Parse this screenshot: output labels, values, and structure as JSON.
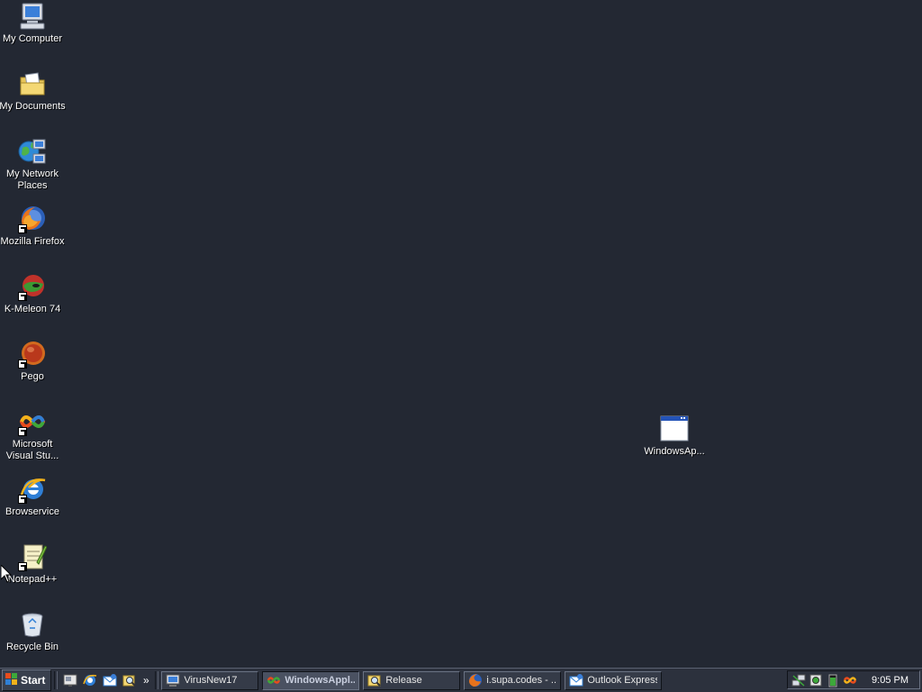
{
  "desktop": {
    "background_color": "#232833",
    "icons": [
      {
        "label": "My Computer",
        "icon": "my-computer-icon"
      },
      {
        "label": "My Documents",
        "icon": "folder-icon"
      },
      {
        "label": "My Network Places",
        "icon": "network-places-icon"
      },
      {
        "label": "Mozilla Firefox",
        "icon": "firefox-icon"
      },
      {
        "label": "K-Meleon 74",
        "icon": "k-meleon-icon"
      },
      {
        "label": "Pego",
        "icon": "pego-icon"
      },
      {
        "label": "Microsoft Visual Stu...",
        "icon": "visual-studio-icon"
      },
      {
        "label": "Browservice",
        "icon": "internet-explorer-icon"
      },
      {
        "label": "Notepad++",
        "icon": "notepad-plus-plus-icon"
      },
      {
        "label": "Recycle Bin",
        "icon": "recycle-bin-icon"
      },
      {
        "label": "WindowsAp...",
        "icon": "application-window-icon"
      }
    ]
  },
  "taskbar": {
    "start_label": "Start",
    "quick_launch": [
      "show-desktop-icon",
      "internet-explorer-icon",
      "outlook-express-icon",
      "search-icon"
    ],
    "quick_launch_more": "»",
    "tasks": [
      {
        "label": "VirusNew17",
        "icon": "monitor-icon",
        "active": false
      },
      {
        "label": "WindowsAppl...",
        "icon": "visual-studio-icon",
        "active": true
      },
      {
        "label": "Release",
        "icon": "search-folder-icon",
        "active": false
      },
      {
        "label": "i.supa.codes - ...",
        "icon": "firefox-icon",
        "active": false
      },
      {
        "label": "Outlook Express",
        "icon": "outlook-express-icon",
        "active": false
      }
    ],
    "tray_icons": [
      "network-icon",
      "speaker-icon",
      "battery-icon",
      "visual-studio-tray-icon"
    ],
    "clock": "9:05 PM"
  }
}
